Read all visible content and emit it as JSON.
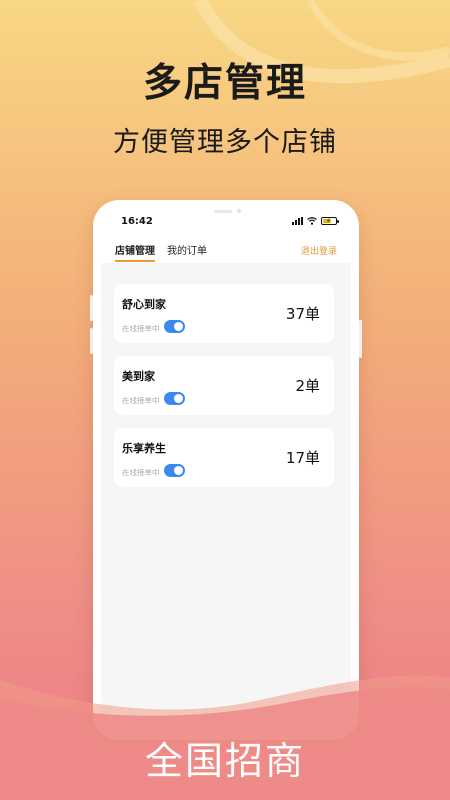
{
  "promo": {
    "headline": "多店管理",
    "subline": "方便管理多个店铺",
    "footer": "全国招商"
  },
  "status_bar": {
    "time": "16:42",
    "icons": [
      "signal-icon",
      "wifi-icon",
      "battery-charging-icon"
    ]
  },
  "tabs": [
    {
      "label": "店铺管理",
      "active": true
    },
    {
      "label": "我的订单",
      "active": false
    }
  ],
  "logout_label": "退出登录",
  "stores": [
    {
      "name": "舒心到家",
      "status_label": "在线接单中",
      "accepting": true,
      "orders": "37单"
    },
    {
      "name": "美到家",
      "status_label": "在线接单中",
      "accepting": true,
      "orders": "2单"
    },
    {
      "name": "乐享养生",
      "status_label": "在线接单中",
      "accepting": true,
      "orders": "17单"
    }
  ],
  "colors": {
    "accent": "#ee9a3a",
    "toggle_on": "#3c87f0",
    "bg_top": "#f8d784",
    "bg_bottom": "#ec7b88"
  }
}
